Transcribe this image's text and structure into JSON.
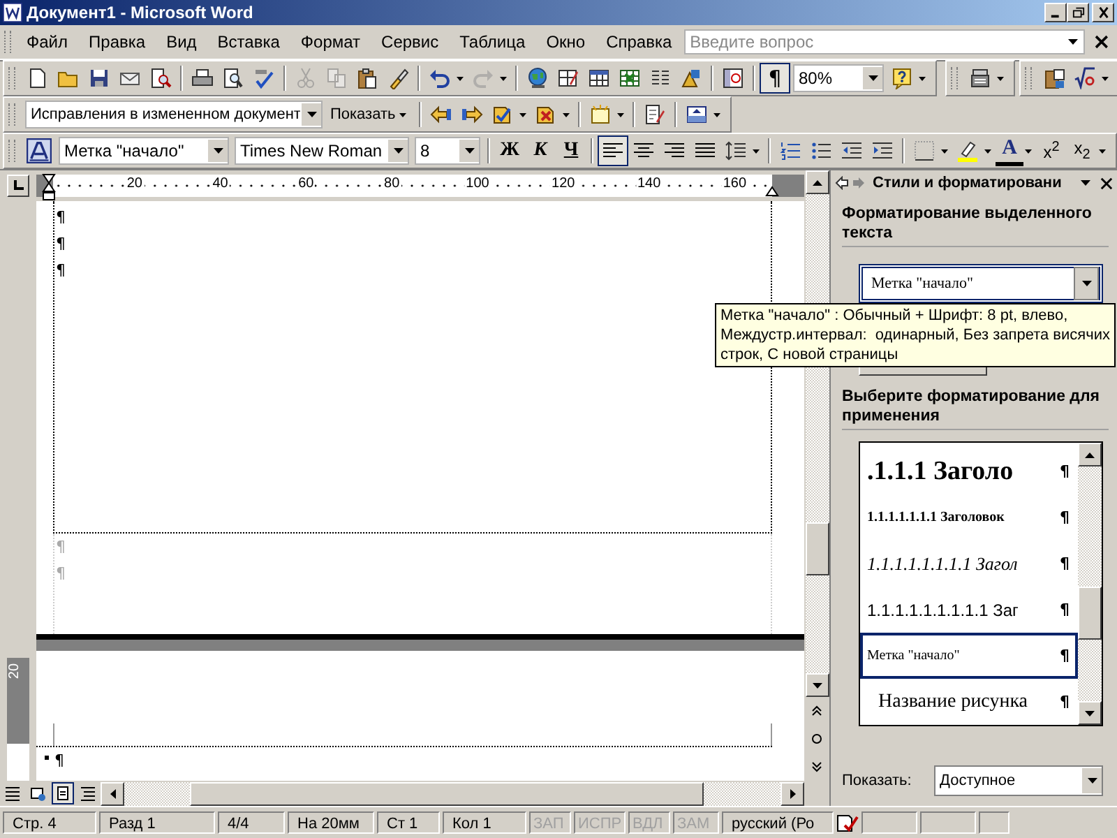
{
  "window": {
    "title": "Документ1 - Microsoft Word"
  },
  "menu": [
    "Файл",
    "Правка",
    "Вид",
    "Вставка",
    "Формат",
    "Сервис",
    "Таблица",
    "Окно",
    "Справка"
  ],
  "help_field": {
    "placeholder": "Введите вопрос"
  },
  "standard_toolbar": {
    "show_marks": {
      "label": "¶",
      "selected": true
    },
    "zoom": "80%"
  },
  "review_toolbar": {
    "display_combo": "Исправления в измененном документ",
    "show_button": "Показать"
  },
  "formatting_toolbar": {
    "style": "Метка \"начало\"",
    "font": "Times New Roman",
    "size": "8",
    "font_styles": [
      {
        "label": "Ж",
        "kind": "bold"
      },
      {
        "label": "К",
        "kind": "italic"
      },
      {
        "label": "Ч",
        "kind": "underline"
      }
    ],
    "alignments": [
      {
        "kind": "left",
        "selected": true
      },
      {
        "kind": "center",
        "selected": false
      },
      {
        "kind": "right",
        "selected": false
      },
      {
        "kind": "justify",
        "selected": false
      }
    ],
    "font_color_label": "A",
    "superscript": "x$^{2}$",
    "subscript": "x$_{2}$"
  },
  "ruler": {
    "labels": [
      "20",
      "40",
      "60",
      "80",
      "100",
      "120",
      "140",
      "160"
    ]
  },
  "vertical_ruler": {
    "label": "20"
  },
  "document": {
    "body_marks": [
      "¶",
      "¶",
      "¶"
    ],
    "header_marks": [
      "¶",
      "¶"
    ],
    "next_page_mark": "¶"
  },
  "tooltip": {
    "text": "Метка \"начало\" : Обычный + Шрифт: 8 pt, влево,\nМеждустр.интервал:  одинарный, Без запрета висячих\nстрок, С новой страницы"
  },
  "task_pane": {
    "title": "Стили и форматировани",
    "selected_heading": "Форматирование выделенного текста",
    "current_style": "Метка \"начало\"",
    "apply_heading": "Выберите форматирование для применения",
    "styles": [
      {
        "label": ".1.1.1  Заголо",
        "kind": "heading1",
        "mark": "¶",
        "selected": false
      },
      {
        "label": "1.1.1.1.1.1.1  Заголовок",
        "kind": "bold",
        "mark": "¶",
        "selected": false
      },
      {
        "label": "1.1.1.1.1.1.1.1  Загол",
        "kind": "italic",
        "mark": "¶",
        "selected": false
      },
      {
        "label": "1.1.1.1.1.1.1.1.1  Заг",
        "kind": "sans",
        "mark": "¶",
        "selected": false
      },
      {
        "label": "Метка \"начало\"",
        "kind": "small",
        "mark": "¶",
        "selected": true
      },
      {
        "label": "Название рисунка",
        "kind": "caption",
        "mark": "¶",
        "selected": false
      }
    ],
    "show_label": "Показать:",
    "show_value": "Доступное"
  },
  "status_bar": {
    "fields": [
      {
        "text": "Стр. 4",
        "disabled": false
      },
      {
        "text": "Разд 1",
        "disabled": false
      },
      {
        "text": "4/4",
        "disabled": false
      },
      {
        "text": "На 20мм",
        "disabled": false
      },
      {
        "text": "Ст 1",
        "disabled": false
      },
      {
        "text": "Кол 1",
        "disabled": false
      },
      {
        "text": "ЗАП",
        "disabled": true
      },
      {
        "text": "ИСПР",
        "disabled": true
      },
      {
        "text": "ВДЛ",
        "disabled": true
      },
      {
        "text": "ЗАМ",
        "disabled": true
      },
      {
        "text": "русский (Ро",
        "disabled": false
      }
    ]
  }
}
